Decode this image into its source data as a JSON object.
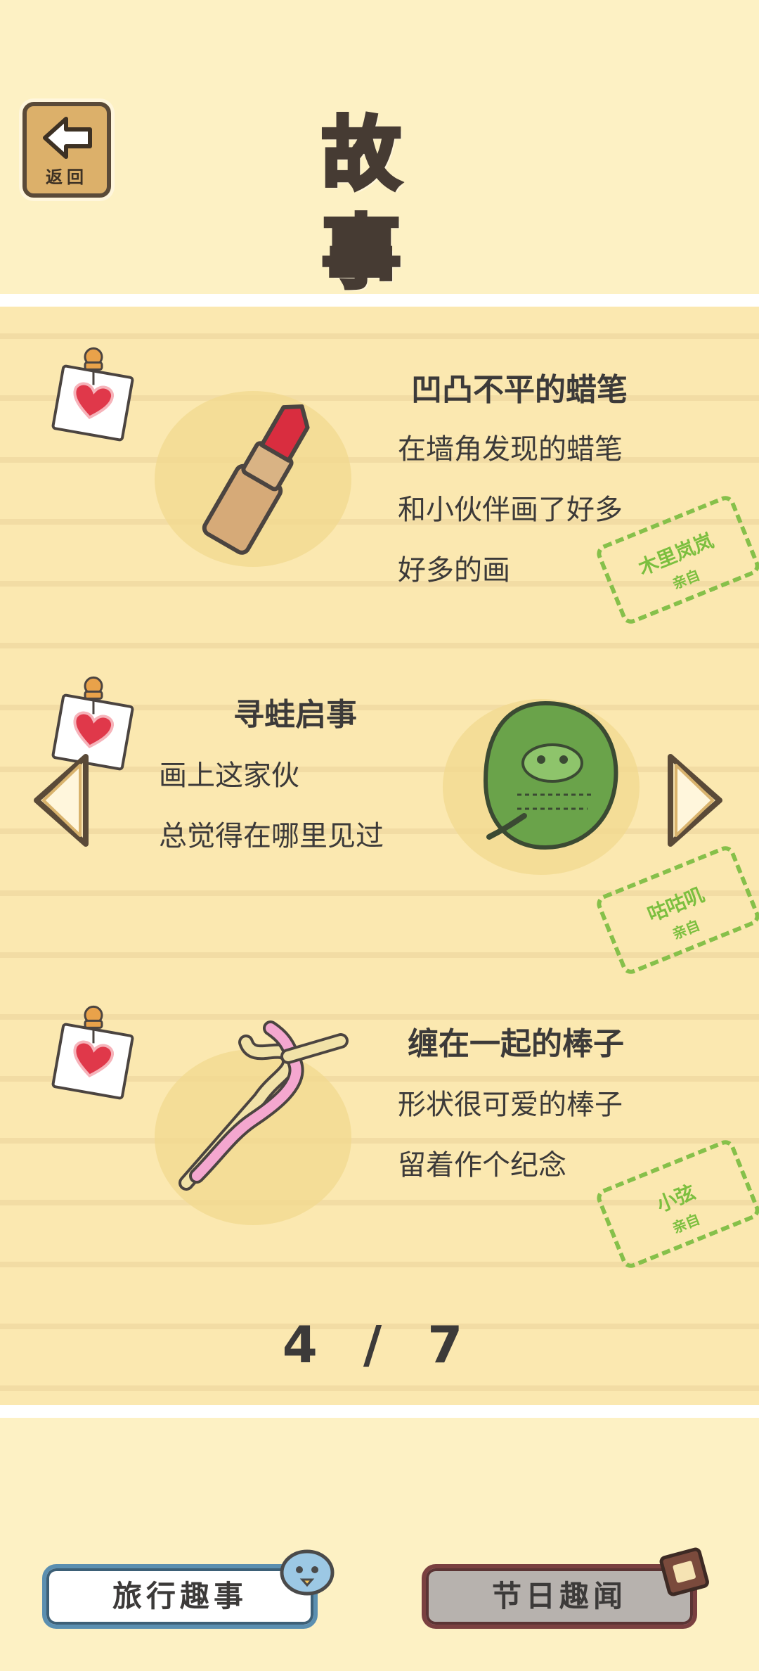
{
  "header": {
    "title": "故 事",
    "back_label": "返回"
  },
  "stories": [
    {
      "title": "凹凸不平的蜡笔",
      "lines": [
        "在墙角发现的蜡笔",
        "和小伙伴画了好多",
        "好多的画"
      ],
      "stamp_name": "木里岚岚",
      "stamp_sub": "亲自",
      "item_icon": "lipstick-crayon-icon"
    },
    {
      "title": "寻蛙启事",
      "lines": [
        "画上这家伙",
        "总觉得在哪里见过"
      ],
      "stamp_name": "咕咕叽",
      "stamp_sub": "亲自",
      "item_icon": "frog-leaf-drawing-icon"
    },
    {
      "title": "缠在一起的棒子",
      "lines": [
        "形状很可爱的棒子",
        "留着作个纪念"
      ],
      "stamp_name": "小弦",
      "stamp_sub": "亲自",
      "item_icon": "twisted-sticks-icon"
    }
  ],
  "pagination": {
    "text": "4 / 7",
    "current": 4,
    "total": 7
  },
  "tabs": {
    "travel_label": "旅行趣事",
    "festival_label": "节日趣闻"
  },
  "colors": {
    "background": "#fdf1c4",
    "stamp_green": "#7cbf3f",
    "heart_red": "#e0384a"
  }
}
